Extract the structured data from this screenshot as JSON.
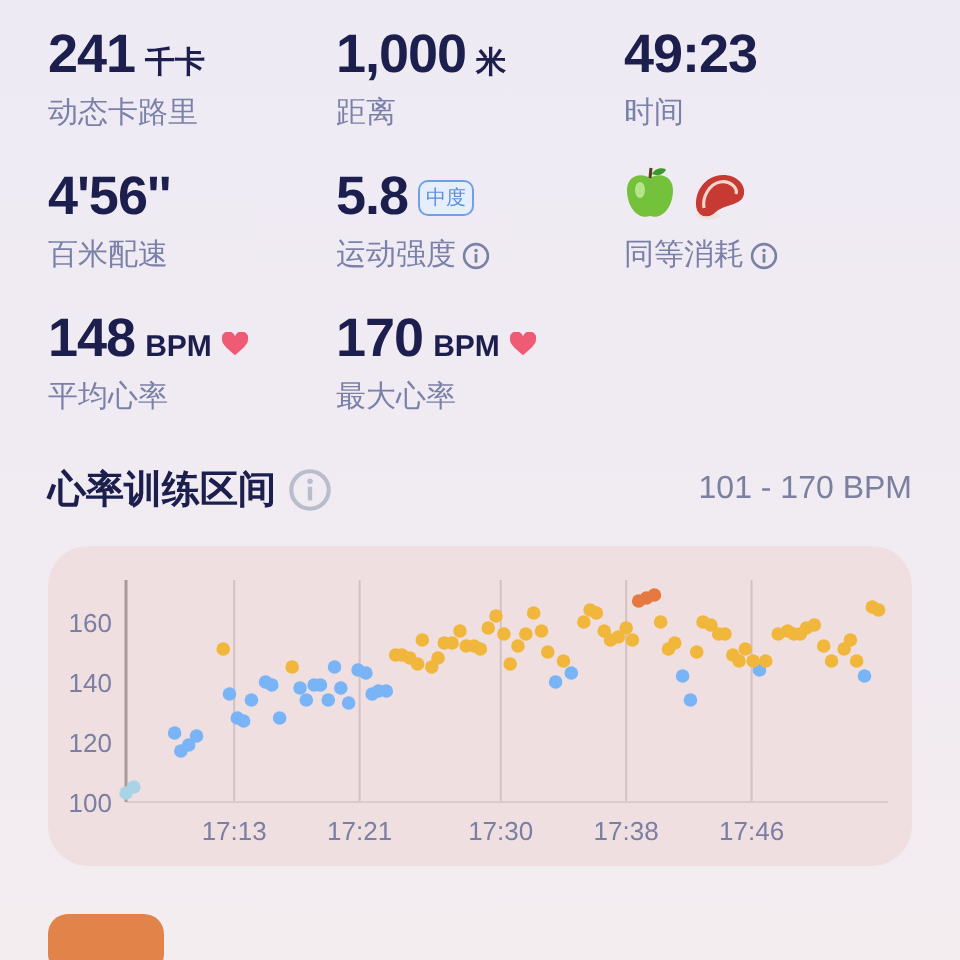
{
  "stats": [
    {
      "kind": "plain",
      "value": "241",
      "unit": "千卡",
      "label": "动态卡路里"
    },
    {
      "kind": "plain",
      "value": "1,000",
      "unit": "米",
      "label": "距离"
    },
    {
      "kind": "plain",
      "value": "49:23",
      "label": "时间"
    },
    {
      "kind": "plain",
      "value": "4'56''",
      "label": "百米配速"
    },
    {
      "kind": "intensity",
      "value": "5.8",
      "badge": "中度",
      "label": "运动强度",
      "info": true
    },
    {
      "kind": "food",
      "label": "同等消耗",
      "info": true
    },
    {
      "kind": "heart_rate",
      "value": "148",
      "unit": "BPM",
      "label": "平均心率"
    },
    {
      "kind": "heart_rate",
      "value": "170",
      "unit": "BPM",
      "label": "最大心率"
    }
  ],
  "heart_rate_zones": {
    "title": "心率训练区间",
    "info": true,
    "range": "101 - 170 BPM",
    "chart_data": {
      "type": "scatter",
      "grid": true,
      "xlim": [
        1026.1,
        1074.7
      ],
      "ylim": [
        100,
        174
      ],
      "xticks": [
        {
          "value": 1033,
          "label": "17:13"
        },
        {
          "value": 1041,
          "label": "17:21"
        },
        {
          "value": 1050,
          "label": "17:30"
        },
        {
          "value": 1058,
          "label": "17:38"
        },
        {
          "value": 1066,
          "label": "17:46"
        }
      ],
      "yticks": [
        100,
        120,
        140,
        160
      ],
      "series": [
        {
          "color": "#a8d4e6",
          "x": [
            1026.1,
            1026.6
          ],
          "values": [
            103,
            105
          ]
        },
        {
          "color": "#79b4f7",
          "x": [
            1029.2,
            1029.6,
            1030.1,
            1030.6,
            1032.7,
            1033.2,
            1033.6,
            1034.1,
            1035.0,
            1035.4,
            1035.9,
            1037.2,
            1037.6,
            1038.1,
            1038.5,
            1039.0,
            1039.4,
            1039.8,
            1040.3,
            1040.9,
            1041.4,
            1041.8,
            1042.2,
            1042.7,
            1053.5,
            1054.5,
            1061.6,
            1062.1,
            1066.5,
            1073.2
          ],
          "values": [
            123,
            117,
            119,
            122,
            136,
            128,
            127,
            134,
            140,
            139,
            128,
            138,
            134,
            139,
            139,
            134,
            145,
            138,
            133,
            144,
            143,
            136,
            137,
            137,
            140,
            143,
            142,
            134,
            144,
            142
          ]
        },
        {
          "color": "#f0b73c",
          "x": [
            1032.3,
            1036.7,
            1043.3,
            1043.7,
            1044.2,
            1044.7,
            1045.0,
            1045.6,
            1046.0,
            1046.4,
            1046.9,
            1047.4,
            1047.8,
            1048.3,
            1048.7,
            1049.2,
            1049.7,
            1050.2,
            1050.6,
            1051.1,
            1051.6,
            1052.1,
            1052.6,
            1053.0,
            1054.0,
            1055.3,
            1055.7,
            1056.1,
            1056.6,
            1057.0,
            1057.5,
            1058.0,
            1058.4,
            1060.2,
            1060.7,
            1061.1,
            1062.5,
            1062.9,
            1063.4,
            1063.9,
            1064.3,
            1064.8,
            1065.2,
            1065.6,
            1066.1,
            1066.9,
            1067.7,
            1068.3,
            1068.7,
            1069.1,
            1069.5,
            1070.0,
            1070.6,
            1071.1,
            1071.9,
            1072.3,
            1072.7,
            1073.7,
            1074.1
          ],
          "values": [
            151,
            145,
            149,
            149,
            148,
            146,
            154,
            145,
            148,
            153,
            153,
            157,
            152,
            152,
            151,
            158,
            162,
            156,
            146,
            152,
            156,
            163,
            157,
            150,
            147,
            160,
            164,
            163,
            157,
            154,
            155,
            158,
            154,
            160,
            151,
            153,
            150,
            160,
            159,
            156,
            156,
            149,
            147,
            151,
            147,
            147,
            156,
            157,
            156,
            156,
            158,
            159,
            152,
            147,
            151,
            154,
            147,
            165,
            164
          ]
        },
        {
          "color": "#e5793f",
          "x": [
            1058.8,
            1059.3,
            1059.8
          ],
          "values": [
            167,
            168,
            169
          ]
        }
      ]
    }
  }
}
